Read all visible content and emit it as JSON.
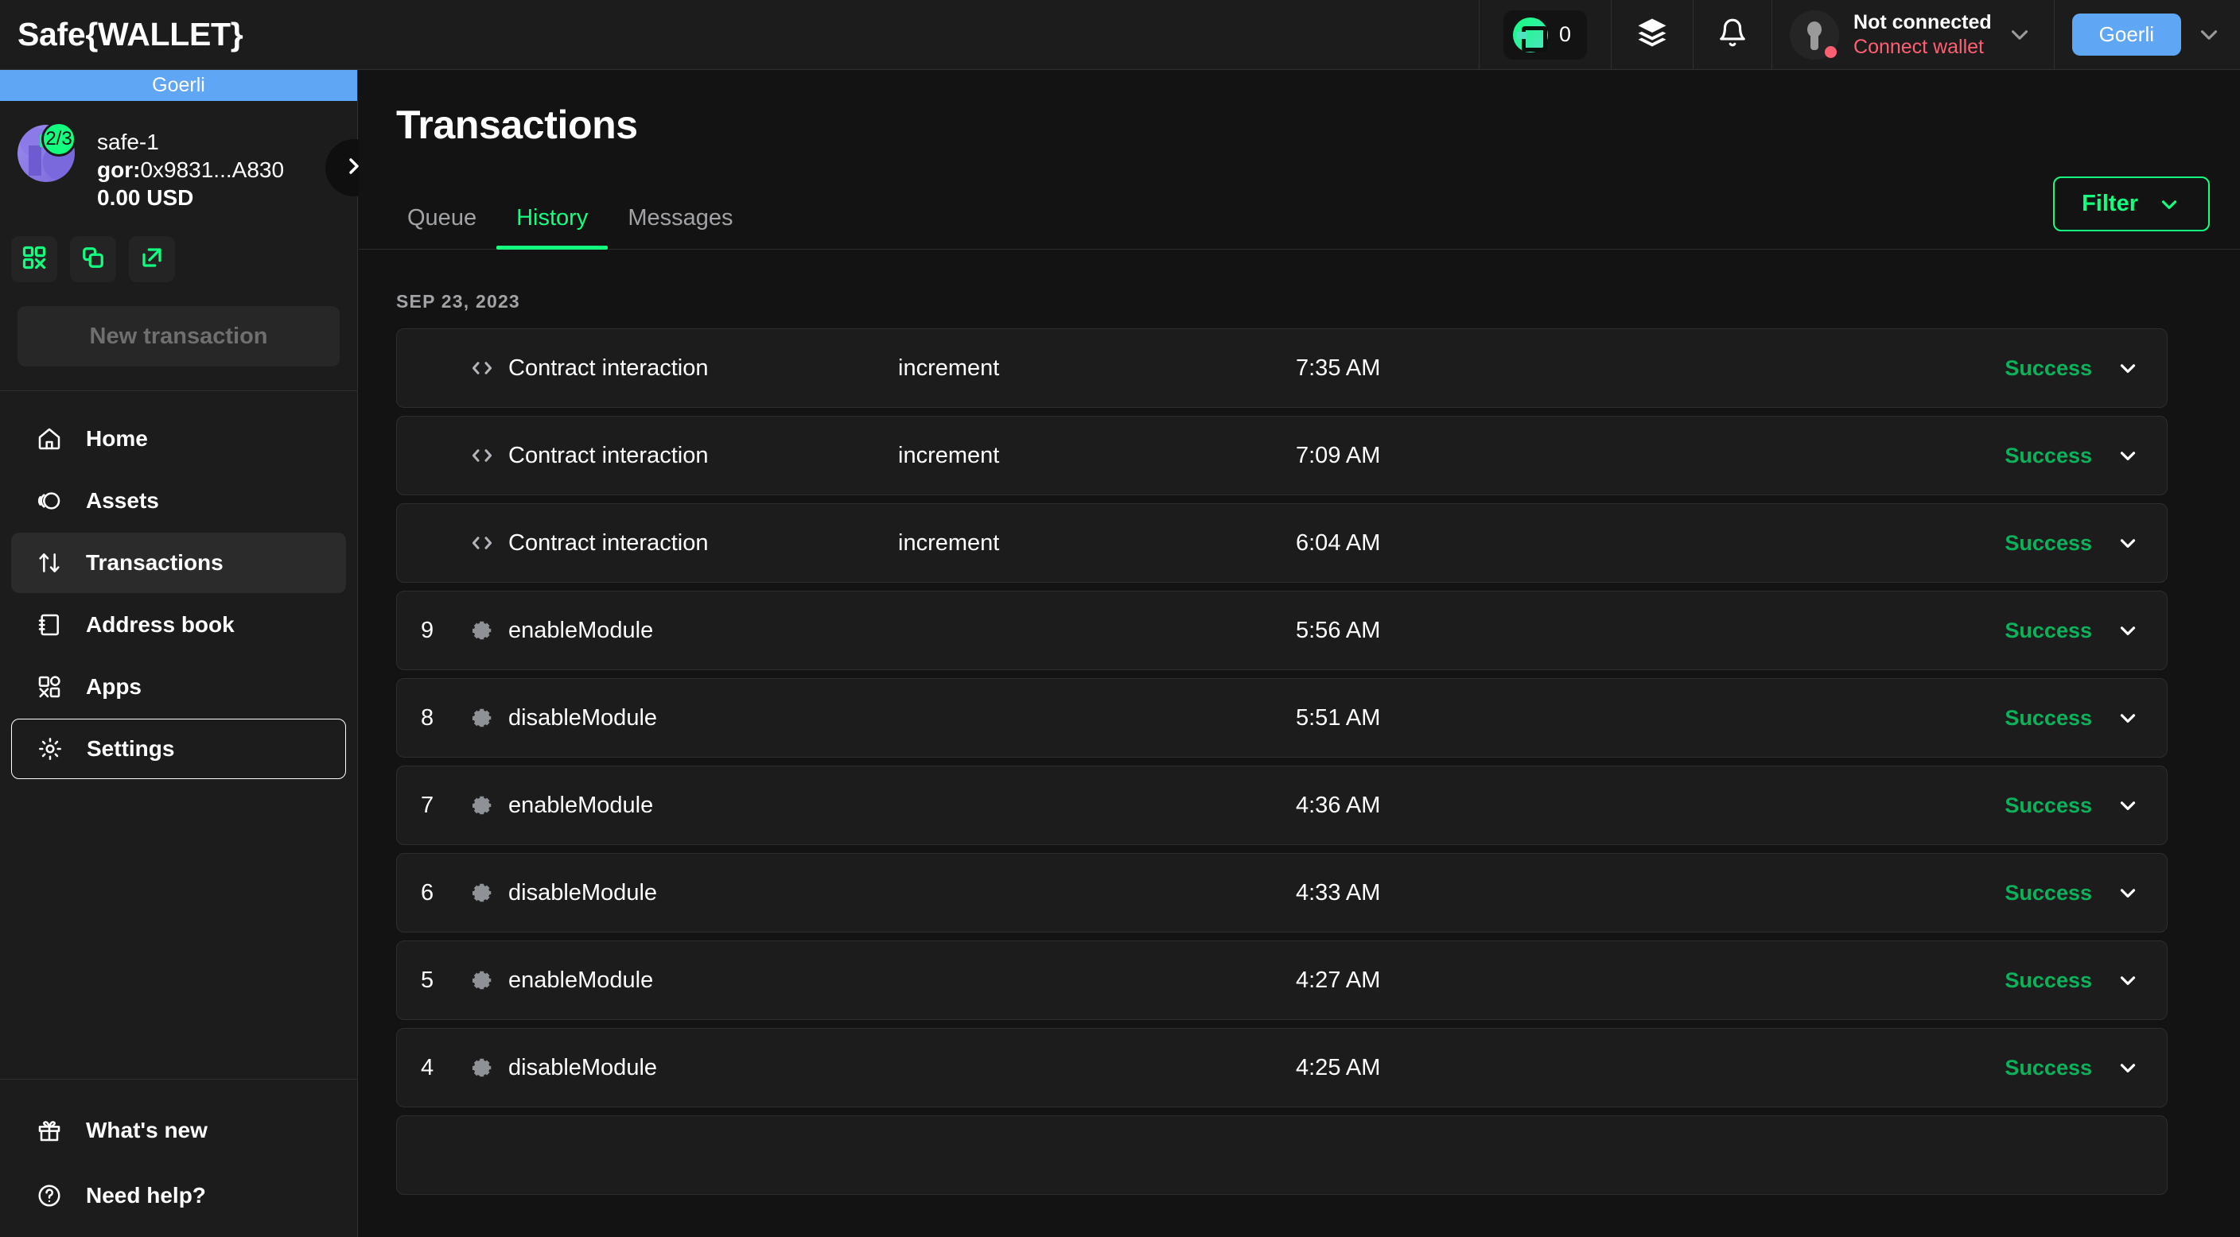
{
  "header": {
    "brand": "Safe{WALLET}",
    "safe_token_count": "0",
    "safe_token_icon": "safe-logo-icon",
    "batch_icon": "layers-icon",
    "notifications_icon": "bell-icon",
    "wallet": {
      "status": "Not connected",
      "action": "Connect wallet",
      "avatar_icon": "wallet-avatar-icon",
      "chevron_icon": "chevron-down-icon"
    },
    "network": {
      "name": "Goerli",
      "chevron_icon": "chevron-down-icon"
    }
  },
  "sidebar": {
    "network_banner": "Goerli",
    "safe": {
      "threshold": "2/3",
      "name": "safe-1",
      "address_prefix": "gor:",
      "address": "0x9831...A830",
      "balance": "0.00 USD",
      "expand_icon": "chevron-right-icon"
    },
    "actions": [
      {
        "name": "qr-code-button",
        "icon": "qr-code-icon"
      },
      {
        "name": "copy-address-button",
        "icon": "copy-icon"
      },
      {
        "name": "open-explorer-button",
        "icon": "external-link-icon"
      }
    ],
    "new_transaction_label": "New transaction",
    "items": [
      {
        "label": "Home",
        "icon": "home-icon",
        "active": false
      },
      {
        "label": "Assets",
        "icon": "assets-icon",
        "active": false
      },
      {
        "label": "Transactions",
        "icon": "transactions-icon",
        "active": true
      },
      {
        "label": "Address book",
        "icon": "address-book-icon",
        "active": false
      },
      {
        "label": "Apps",
        "icon": "apps-icon",
        "active": false
      },
      {
        "label": "Settings",
        "icon": "gear-icon",
        "active": false,
        "outlined": true
      }
    ],
    "bottom_items": [
      {
        "label": "What's new",
        "icon": "gift-icon"
      },
      {
        "label": "Need help?",
        "icon": "help-circle-icon"
      }
    ]
  },
  "main": {
    "title": "Transactions",
    "tabs": [
      {
        "label": "Queue",
        "active": false
      },
      {
        "label": "History",
        "active": true
      },
      {
        "label": "Messages",
        "active": false
      }
    ],
    "filter": {
      "label": "Filter",
      "chevron_icon": "chevron-down-icon"
    },
    "date_group": "SEP 23, 2023",
    "transactions": [
      {
        "nonce": "",
        "type": "Contract interaction",
        "type_icon": "code-icon",
        "info": "increment",
        "time": "7:35 AM",
        "status": "Success",
        "chevron_icon": "chevron-down-icon"
      },
      {
        "nonce": "",
        "type": "Contract interaction",
        "type_icon": "code-icon",
        "info": "increment",
        "time": "7:09 AM",
        "status": "Success",
        "chevron_icon": "chevron-down-icon"
      },
      {
        "nonce": "",
        "type": "Contract interaction",
        "type_icon": "code-icon",
        "info": "increment",
        "time": "6:04 AM",
        "status": "Success",
        "chevron_icon": "chevron-down-icon"
      },
      {
        "nonce": "9",
        "type": "enableModule",
        "type_icon": "gear-icon",
        "info": "",
        "time": "5:56 AM",
        "status": "Success",
        "chevron_icon": "chevron-down-icon"
      },
      {
        "nonce": "8",
        "type": "disableModule",
        "type_icon": "gear-icon",
        "info": "",
        "time": "5:51 AM",
        "status": "Success",
        "chevron_icon": "chevron-down-icon"
      },
      {
        "nonce": "7",
        "type": "enableModule",
        "type_icon": "gear-icon",
        "info": "",
        "time": "4:36 AM",
        "status": "Success",
        "chevron_icon": "chevron-down-icon"
      },
      {
        "nonce": "6",
        "type": "disableModule",
        "type_icon": "gear-icon",
        "info": "",
        "time": "4:33 AM",
        "status": "Success",
        "chevron_icon": "chevron-down-icon"
      },
      {
        "nonce": "5",
        "type": "enableModule",
        "type_icon": "gear-icon",
        "info": "",
        "time": "4:27 AM",
        "status": "Success",
        "chevron_icon": "chevron-down-icon"
      },
      {
        "nonce": "4",
        "type": "disableModule",
        "type_icon": "gear-icon",
        "info": "",
        "time": "4:25 AM",
        "status": "Success",
        "chevron_icon": "chevron-down-icon"
      },
      {
        "nonce": "",
        "type": "",
        "type_icon": "",
        "info": "",
        "time": "",
        "status": "",
        "chevron_icon": ""
      }
    ]
  },
  "colors": {
    "accent_green": "#12ff80",
    "success_green": "#0cb259",
    "network_blue": "#5fa6f5",
    "error_red": "#ff5f72",
    "surface": "#1c1c1c",
    "background": "#121312"
  }
}
